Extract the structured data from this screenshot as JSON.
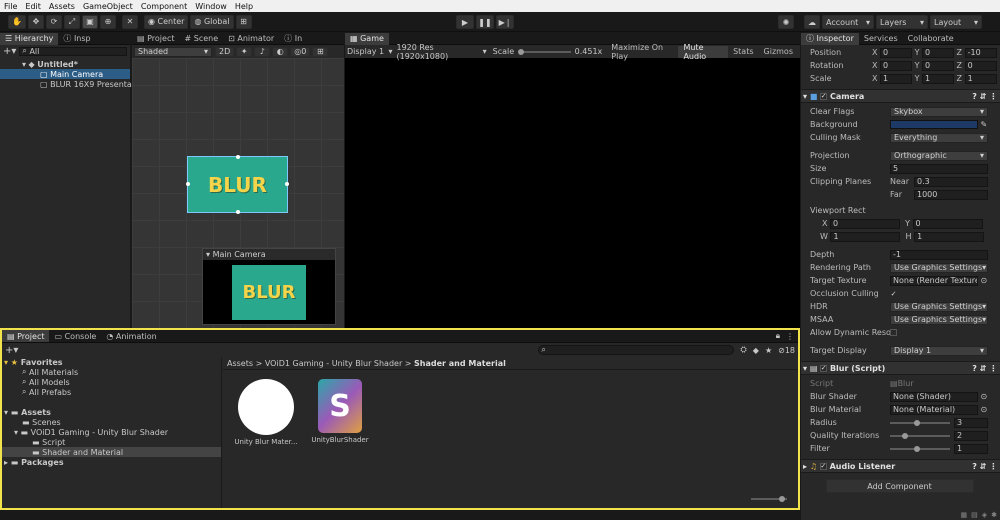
{
  "menu": [
    "File",
    "Edit",
    "Assets",
    "GameObject",
    "Component",
    "Window",
    "Help"
  ],
  "toolbar": {
    "center": "Center",
    "global": "Global",
    "account": "Account",
    "layers": "Layers",
    "layout": "Layout"
  },
  "hierarchy": {
    "tab1": "Hierarchy",
    "tab2": "Insp",
    "search": "All",
    "scene": "Untitled*",
    "items": [
      "Main Camera",
      "BLUR 16X9 Presentat"
    ]
  },
  "scene": {
    "tabs": [
      "Project",
      "Scene",
      "Animator",
      "In"
    ],
    "shading": "Shaded",
    "mode2d": "2D",
    "gizmo_count": "0",
    "blur_text": "BLUR",
    "camera_preview": "Main Camera"
  },
  "game": {
    "tab": "Game",
    "display": "Display 1",
    "res": "1920 Res (1920x1080)",
    "scale_label": "Scale",
    "scale_value": "0.451x",
    "maximize": "Maximize On Play",
    "mute": "Mute Audio",
    "stats": "Stats",
    "gizmos": "Gizmos"
  },
  "inspector": {
    "tabs": [
      "Inspector",
      "Services",
      "Collaborate"
    ],
    "transform": [
      {
        "label": "Position",
        "x": "0",
        "y": "0",
        "z": "-10"
      },
      {
        "label": "Rotation",
        "x": "0",
        "y": "0",
        "z": "0"
      },
      {
        "label": "Scale",
        "x": "1",
        "y": "1",
        "z": "1"
      }
    ],
    "camera": {
      "title": "Camera",
      "clear_flags": "Skybox",
      "background": "Background",
      "culling_mask": "Everything",
      "projection": "Orthographic",
      "size": "5",
      "near": "0.3",
      "far": "1000",
      "viewport_label": "Viewport Rect",
      "vx": "0",
      "vy": "0",
      "vw": "1",
      "vh": "1",
      "depth": "-1",
      "rendering_path": "Use Graphics Settings",
      "target_texture": "None (Render Texture)",
      "hdr": "Use Graphics Settings",
      "msaa": "Use Graphics Settings",
      "target_display": "Display 1",
      "labels": {
        "clear_flags": "Clear Flags",
        "culling": "Culling Mask",
        "projection": "Projection",
        "size": "Size",
        "clipping": "Clipping Planes",
        "near": "Near",
        "far": "Far",
        "depth": "Depth",
        "rendering": "Rendering Path",
        "target": "Target Texture",
        "occlusion": "Occlusion Culling",
        "hdr": "HDR",
        "msaa": "MSAA",
        "dynamic": "Allow Dynamic Reso",
        "display": "Target Display"
      }
    },
    "blur": {
      "title": "Blur (Script)",
      "script_label": "Script",
      "script_value": "Blur",
      "shader_label": "Blur Shader",
      "shader_value": "None (Shader)",
      "material_label": "Blur Material",
      "material_value": "None (Material)",
      "radius_label": "Radius",
      "radius": "3",
      "qi_label": "Quality Iterations",
      "qi": "2",
      "filter_label": "Filter",
      "filter": "1"
    },
    "audio": "Audio Listener",
    "add_component": "Add Component"
  },
  "project": {
    "tabs": [
      "Project",
      "Console",
      "Animation"
    ],
    "count": "18",
    "favorites": "Favorites",
    "fav_items": [
      "All Materials",
      "All Models",
      "All Prefabs"
    ],
    "assets": "Assets",
    "tree": [
      "Scenes",
      "VOiD1 Gaming - Unity Blur Shader",
      "Script",
      "Shader and Material"
    ],
    "packages": "Packages",
    "breadcrumb": [
      "Assets",
      "VOiD1 Gaming - Unity Blur Shader",
      "Shader and Material"
    ],
    "files": [
      "Unity Blur Mater...",
      "UnityBlurShader"
    ],
    "shader_letter": "S"
  }
}
